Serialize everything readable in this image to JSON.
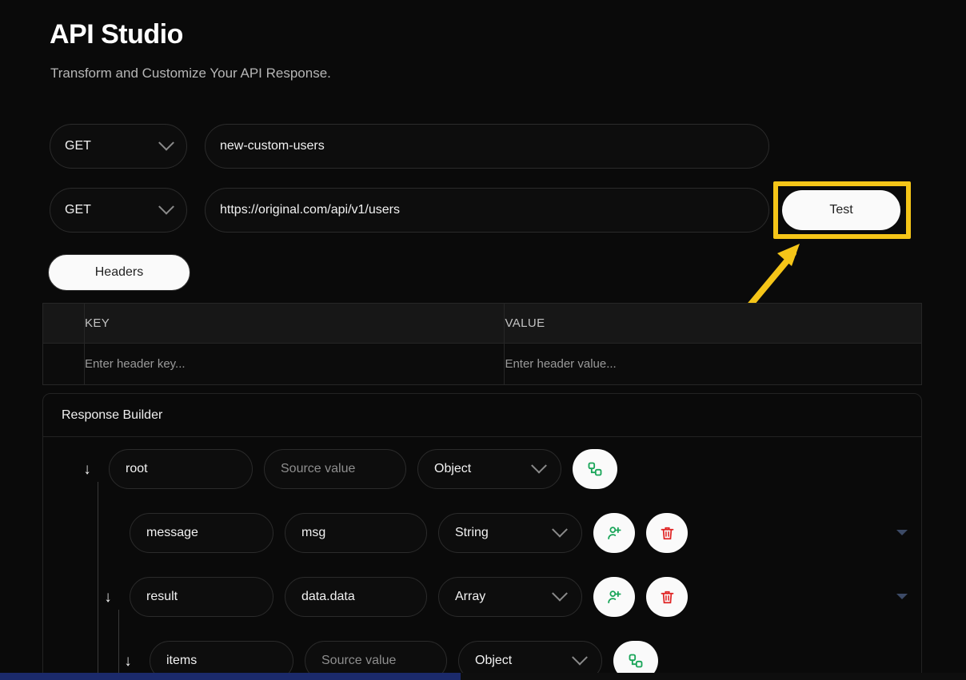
{
  "header": {
    "title": "API Studio",
    "subtitle": "Transform and Customize Your API Response."
  },
  "endpoint_form": {
    "rows": [
      {
        "method": "GET",
        "value": "new-custom-users",
        "method_icon": "chevron-down-icon"
      },
      {
        "method": "GET",
        "value": "https://original.com/api/v1/users",
        "method_icon": "chevron-down-icon"
      }
    ],
    "test_button": "Test"
  },
  "highlight": {
    "color": "#f5c518",
    "target": "Test",
    "annotation_icon": "arrow-up-right-icon"
  },
  "headers_section": {
    "tab_label": "Headers",
    "columns": [
      "",
      "KEY",
      "VALUE"
    ],
    "rows": [
      {
        "handle": "",
        "key_placeholder": "Enter header key...",
        "value_placeholder": "Enter header value..."
      }
    ]
  },
  "response_builder": {
    "panel_title": "Response Builder",
    "nodes": [
      {
        "depth": 0,
        "expand_icon": "arrow-down-icon",
        "name": "root",
        "source": "",
        "source_placeholder": "Source value",
        "type": "Object",
        "type_icon": "chevron-down-icon",
        "actions": [
          "node-tree-icon"
        ]
      },
      {
        "depth": 1,
        "expand_icon": "",
        "name": "message",
        "source": "msg",
        "source_placeholder": "Source value",
        "type": "String",
        "type_icon": "chevron-down-icon",
        "actions": [
          "add-field-icon",
          "delete-icon"
        ],
        "overflow_caret": "caret-down-icon"
      },
      {
        "depth": 1,
        "expand_icon": "arrow-down-icon",
        "name": "result",
        "source": "data.data",
        "source_placeholder": "Source value",
        "type": "Array",
        "type_icon": "chevron-down-icon",
        "actions": [
          "add-field-icon",
          "delete-icon"
        ],
        "overflow_caret": "caret-down-icon"
      },
      {
        "depth": 2,
        "expand_icon": "arrow-down-icon",
        "name": "items",
        "source": "",
        "source_placeholder": "Source value",
        "type": "Object",
        "type_icon": "chevron-down-icon",
        "actions": [
          "node-tree-icon"
        ]
      }
    ]
  },
  "colors": {
    "page_background": "#0a0a0a",
    "accent_highlight": "#f5c518",
    "icon_green": "#18a558",
    "icon_red": "#e02424",
    "scrollbar": "#1b2a6b"
  }
}
